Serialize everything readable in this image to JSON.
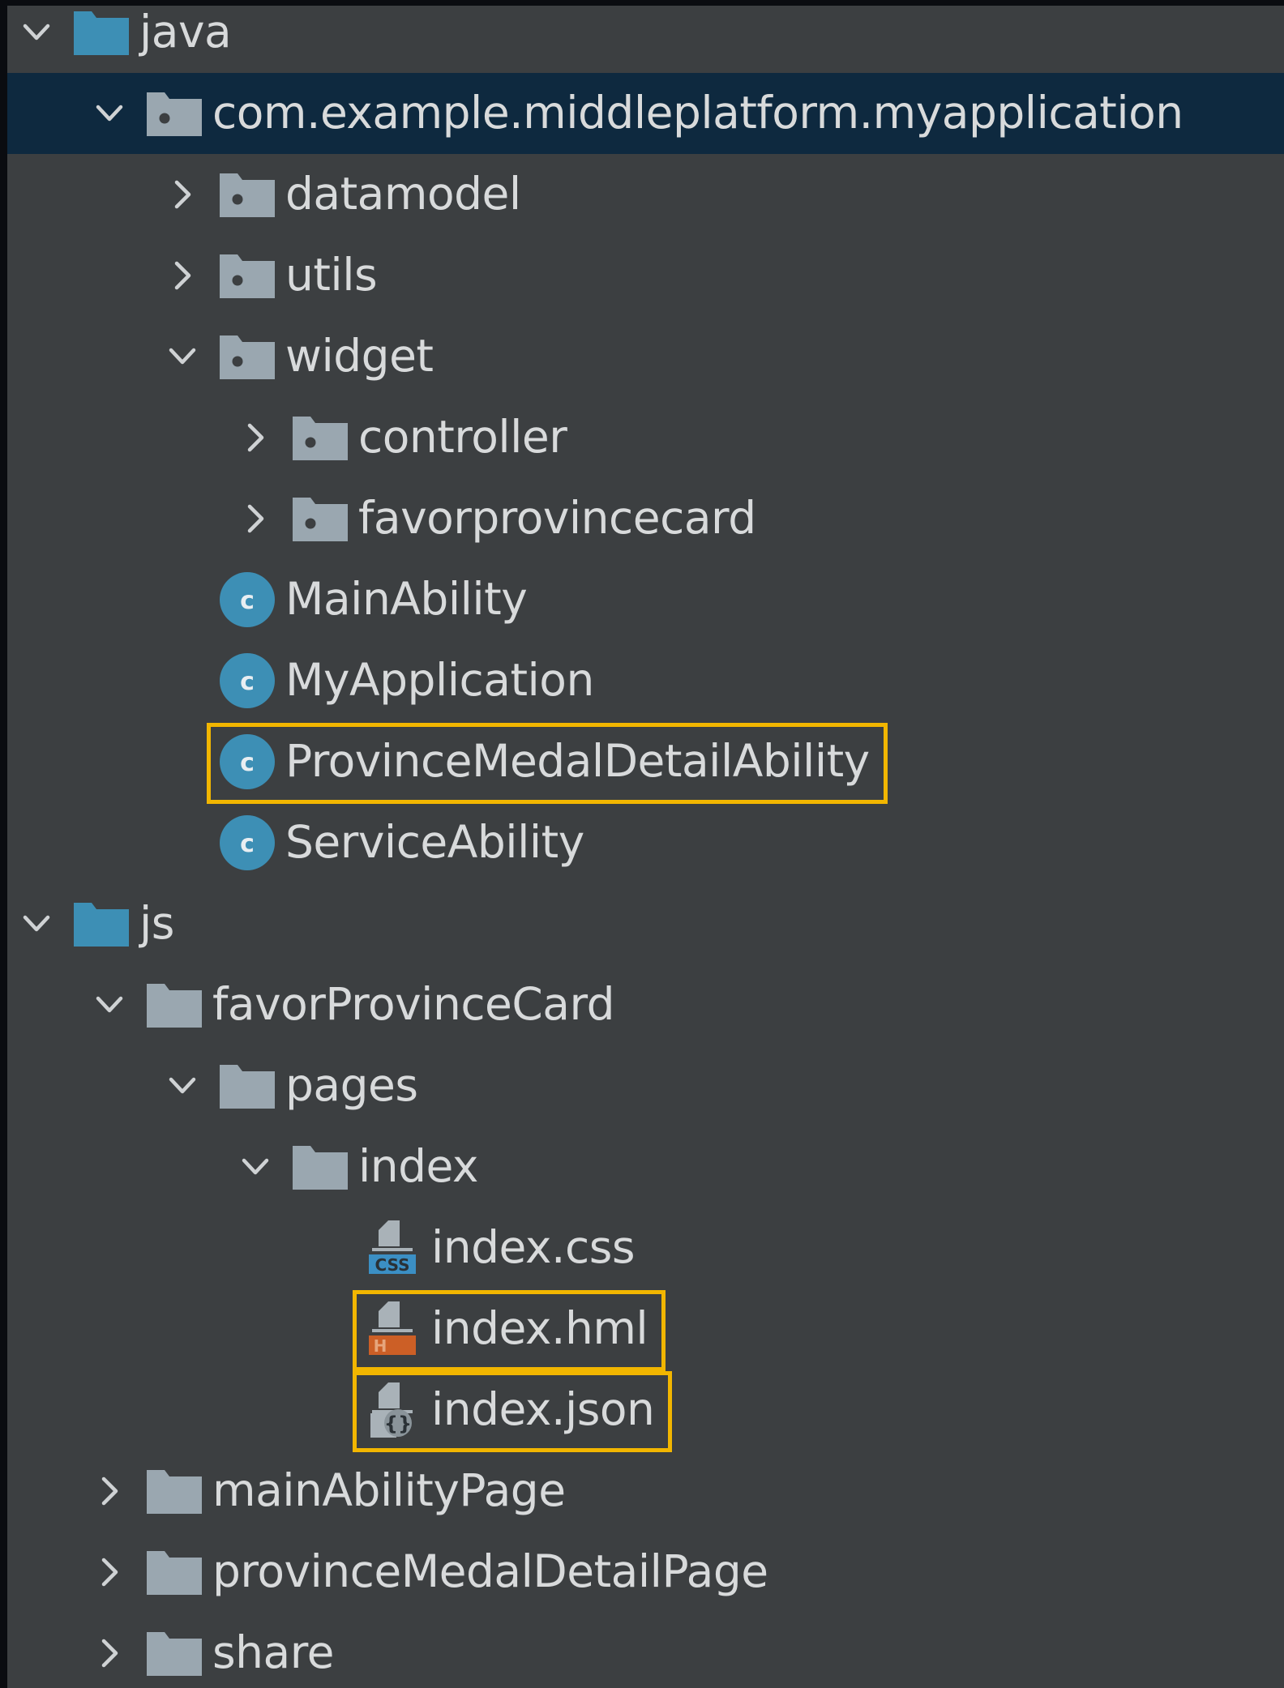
{
  "tree": {
    "items": [
      {
        "label": "java",
        "icon": "source-folder-icon",
        "expanded": true
      },
      {
        "label": "com.example.middleplatform.myapplication",
        "icon": "package-icon",
        "expanded": true,
        "selected": true
      },
      {
        "label": "datamodel",
        "icon": "package-icon",
        "expanded": false
      },
      {
        "label": "utils",
        "icon": "package-icon",
        "expanded": false
      },
      {
        "label": "widget",
        "icon": "package-icon",
        "expanded": true
      },
      {
        "label": "controller",
        "icon": "package-icon",
        "expanded": false
      },
      {
        "label": "favorprovincecard",
        "icon": "package-icon",
        "expanded": false
      },
      {
        "label": "MainAbility",
        "icon": "class-icon"
      },
      {
        "label": "MyApplication",
        "icon": "class-icon"
      },
      {
        "label": "ProvinceMedalDetailAbility",
        "icon": "class-icon",
        "highlighted": true
      },
      {
        "label": "ServiceAbility",
        "icon": "class-icon"
      },
      {
        "label": "js",
        "icon": "source-folder-icon",
        "expanded": true
      },
      {
        "label": "favorProvinceCard",
        "icon": "folder-icon",
        "expanded": true
      },
      {
        "label": "pages",
        "icon": "folder-icon",
        "expanded": true
      },
      {
        "label": "index",
        "icon": "folder-icon",
        "expanded": true
      },
      {
        "label": "index.css",
        "icon": "css-file-icon",
        "badge": "CSS"
      },
      {
        "label": "index.hml",
        "icon": "hml-file-icon",
        "badge": "H",
        "highlighted": true
      },
      {
        "label": "index.json",
        "icon": "json-file-icon",
        "badge": "{}",
        "highlighted": true
      },
      {
        "label": "mainAbilityPage",
        "icon": "folder-icon",
        "expanded": false
      },
      {
        "label": "provinceMedalDetailPage",
        "icon": "folder-icon",
        "expanded": false
      },
      {
        "label": "share",
        "icon": "folder-icon",
        "expanded": false
      }
    ]
  },
  "colors": {
    "panel_bg": "#3c3f41",
    "selected_row": "#0e293f",
    "text": "#d8dadb",
    "chevron": "#cfd2d4",
    "source_folder": "#3d8fb5",
    "folder": "#9aa7b0",
    "class_icon": "#3d8fb5",
    "highlight_border": "#f2b600"
  }
}
